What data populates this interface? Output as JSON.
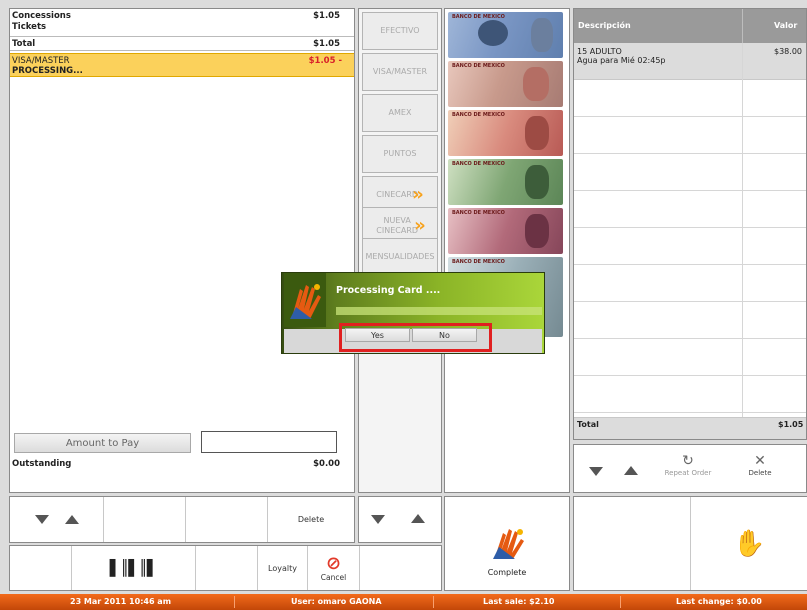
{
  "summary": {
    "rows": [
      {
        "label": "Concessions",
        "amount": "$1.05"
      },
      {
        "label": "Tickets",
        "amount": ""
      },
      {
        "label": "Total",
        "amount": "$1.05"
      }
    ],
    "selected": {
      "label": "VISA/MASTER",
      "status": "PROCESSING...",
      "amount": "$1.05 -"
    },
    "amount_to_pay_label": "Amount to Pay",
    "amount_to_pay_value": "",
    "outstanding_label": "Outstanding",
    "outstanding_value": "$0.00"
  },
  "payment_methods": [
    "EFECTIVO",
    "VISA/MASTER",
    "AMEX",
    "PUNTOS",
    "CINECARD",
    "NUEVA CINECARD",
    "MENSUALIDADES"
  ],
  "bills": [
    {
      "label": "BANCO DE MEXICO",
      "color": "#7a96c4"
    },
    {
      "label": "BANCO DE MEXICO",
      "color": "#c89a8c"
    },
    {
      "label": "BANCO DE MEXICO",
      "color": "#d98b7e"
    },
    {
      "label": "BANCO DE MEXICO",
      "color": "#7fa674"
    },
    {
      "label": "BANCO DE MEXICO",
      "color": "#b26a7a"
    },
    {
      "label": "BANCO DE MEXICO",
      "color": "#9bb0b8"
    }
  ],
  "order": {
    "col_description": "Descripción",
    "col_value": "Valor",
    "items": [
      {
        "line1": "15 ADULTO",
        "line2": "Agua para Mié 02:45p",
        "value": "$38.00"
      }
    ],
    "total_label": "Total",
    "total_value": "$1.05",
    "repeat_label": "Repeat Order",
    "delete_label": "Delete"
  },
  "dialog": {
    "title": "Processing Card ....",
    "yes": "Yes",
    "no": "No"
  },
  "bottom": {
    "delete_label": "Delete",
    "loyalty_label": "Loyalty",
    "cancel_label": "Cancel",
    "complete_label": "Complete"
  },
  "status_bar": {
    "datetime": "23 Mar 2011 10:46 am",
    "user": "User: omaro GAONA",
    "last_sale": "Last sale: $2.10",
    "last_change": "Last change: $0.00"
  },
  "colors": {
    "accent_orange": "#e55a12",
    "selection_yellow": "#fbd15b",
    "header_gray": "#9a9a9a",
    "highlight_red": "#e02020"
  }
}
